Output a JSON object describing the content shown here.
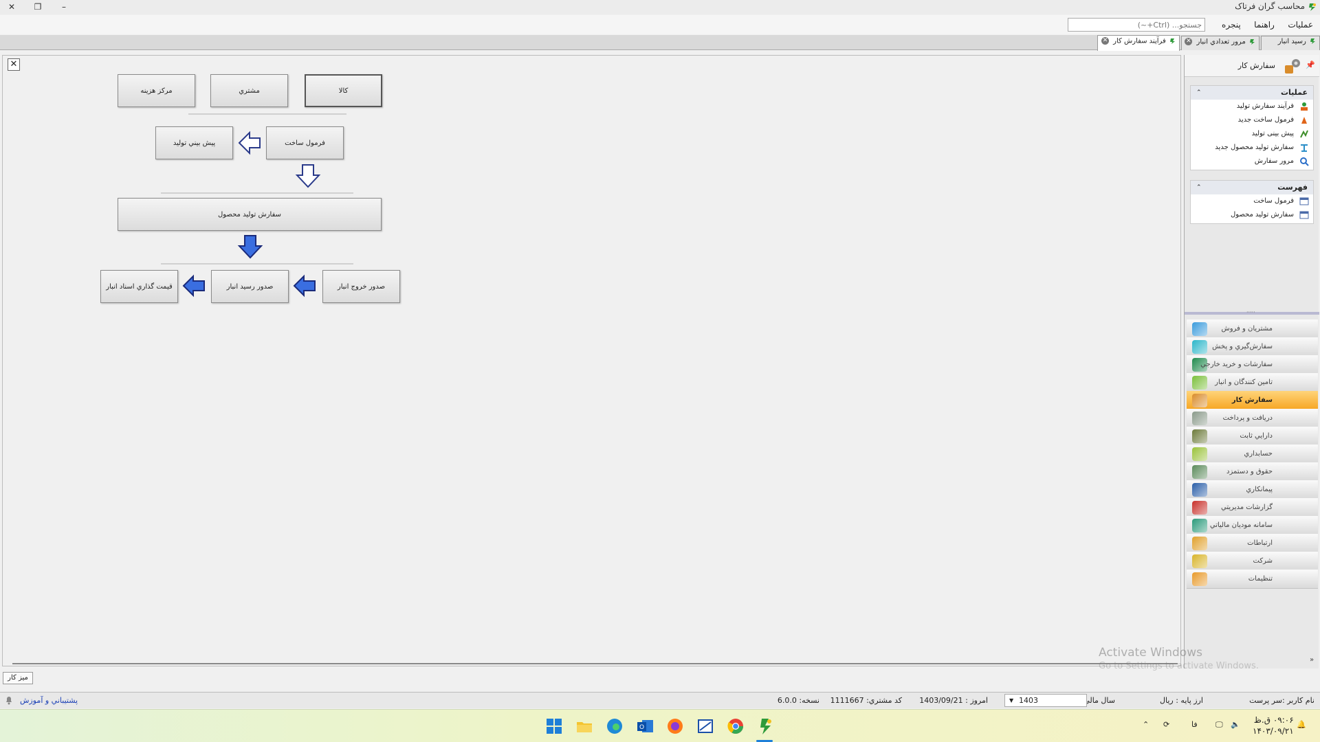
{
  "window": {
    "title": "محاسب گران فرتاک",
    "min_label": "–",
    "max_label": "❐",
    "close_label": "✕"
  },
  "menu": {
    "items": [
      "عملیات",
      "راهنما",
      "پنجره"
    ],
    "search_placeholder": "جستجو... (Ctrl+~)"
  },
  "tabs": [
    {
      "label": "رسید انبار"
    },
    {
      "label": "مرور تعدادي انبار"
    },
    {
      "label": "فرآيند سفارش کار"
    }
  ],
  "flow": {
    "top_buttons": [
      "کالا",
      "مشتري",
      "مرکز هزینه"
    ],
    "formula": "فرمول ساخت",
    "forecast": "پيش بيني توليد",
    "product_order": "سفارش توليد محصول",
    "issue_exit": "صدور خروج انبار",
    "issue_receipt": "صدور رسيد انبار",
    "pricing": "قيمت گذاري اسناد انبار"
  },
  "side_panel": {
    "header_title": "سفارش کار",
    "pin_icon": "pin-icon",
    "operations_title": "عملیات",
    "operations": [
      {
        "label": "فرآیند سفارش تولید",
        "icon": "process-icon",
        "color": "#2e9b3a"
      },
      {
        "label": "فرمول ساخت جدید",
        "icon": "formula-icon",
        "color": "#e0651a"
      },
      {
        "label": "پیش بینی تولید",
        "icon": "forecast-icon",
        "color": "#3e8e2a"
      },
      {
        "label": "سفارش تولید محصول جدید",
        "icon": "product-order-icon",
        "color": "#2a8ec8"
      },
      {
        "label": "مرور سفارش",
        "icon": "review-icon",
        "color": "#2a6ec8"
      }
    ],
    "list_title": "فهرست",
    "list_items": [
      {
        "label": "فرمول ساخت",
        "icon": "list-window-icon"
      },
      {
        "label": "سفارش تولید محصول",
        "icon": "list-window-icon"
      }
    ],
    "modules": [
      {
        "label": "مشتريان و فروش",
        "icon": "sales-icon",
        "color": "#3a9bdc",
        "active": false
      },
      {
        "label": "سفارش‌گيري و پخش",
        "icon": "distribution-icon",
        "color": "#2bb6c9",
        "active": false
      },
      {
        "label": "سفارشات و خريد خارجي",
        "icon": "purchase-icon",
        "color": "#1f8a4c",
        "active": false
      },
      {
        "label": "تامين کنندگان و انبار",
        "icon": "warehouse-icon",
        "color": "#7bbf3a",
        "active": false
      },
      {
        "label": "سفارش کار",
        "icon": "work-order-icon",
        "color": "#d98c2b",
        "active": true
      },
      {
        "label": "دريافت و پرداخت",
        "icon": "payment-icon",
        "color": "#8a9a8a",
        "active": false
      },
      {
        "label": "دارايي ثابت",
        "icon": "assets-icon",
        "color": "#6c7a3a",
        "active": false
      },
      {
        "label": "حسابداري",
        "icon": "accounting-icon",
        "color": "#9ac23a",
        "active": false
      },
      {
        "label": "حقوق و دستمزد",
        "icon": "payroll-icon",
        "color": "#5a8a5a",
        "active": false
      },
      {
        "label": "پيمانکاري",
        "icon": "contracting-icon",
        "color": "#2a5ea8",
        "active": false
      },
      {
        "label": "گزارشات مديريتي",
        "icon": "reports-icon",
        "color": "#c8302a",
        "active": false
      },
      {
        "label": "سامانه موديان مالياتي",
        "icon": "tax-icon",
        "color": "#2a9a7a",
        "active": false
      },
      {
        "label": "ارتباطات",
        "icon": "communications-icon",
        "color": "#e0a02a",
        "active": false
      },
      {
        "label": "شرکت",
        "icon": "company-icon",
        "color": "#d8b42a",
        "active": false
      },
      {
        "label": "تنظيمات",
        "icon": "settings-icon",
        "color": "#e89a2a",
        "active": false
      }
    ]
  },
  "workspace": {
    "desk_tab": "ميز کار",
    "close_label": "✕"
  },
  "watermark": {
    "line1": "Activate Windows",
    "line2": "Go to Settings to activate Windows."
  },
  "status": {
    "username_label": "نام کاربر :",
    "username": "سر پرست",
    "base_currency_label": "ارز پايه :",
    "base_currency": "ريال",
    "fiscal_year_label": "سال مالي:",
    "fiscal_year": "1403",
    "today_label": "امروز :",
    "today": "1403/09/21",
    "customer_code_label": "کد مشتري:",
    "customer_code": "1111667",
    "version_label": "نسخه:",
    "version": "6.0.0",
    "support": "پشتيباني و آموزش"
  },
  "taskbar": {
    "lang": "فا",
    "time": "۰۹:۰۶ ق.ظ",
    "date": "۱۴۰۳/۰۹/۲۱"
  }
}
